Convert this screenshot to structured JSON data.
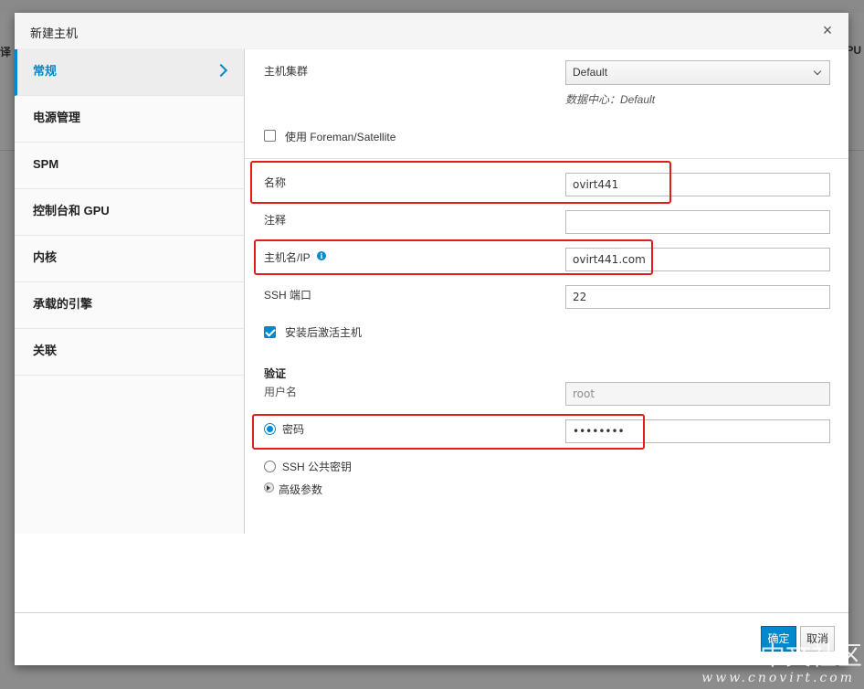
{
  "background": {
    "left_text": "译",
    "right_text": "PU"
  },
  "dialog": {
    "title": "新建主机",
    "close_label": "×"
  },
  "sidebar": {
    "items": [
      {
        "label": "常规"
      },
      {
        "label": "电源管理"
      },
      {
        "label": "SPM"
      },
      {
        "label": "控制台和 GPU"
      },
      {
        "label": "内核"
      },
      {
        "label": "承载的引擎"
      },
      {
        "label": "关联"
      }
    ]
  },
  "form": {
    "cluster": {
      "label": "主机集群",
      "value": "Default",
      "hint": "数据中心：Default"
    },
    "foreman": {
      "label": "使用 Foreman/Satellite",
      "checked": false
    },
    "name": {
      "label": "名称",
      "value": "ovirt441"
    },
    "comment": {
      "label": "注释",
      "value": ""
    },
    "hostname": {
      "label": "主机名/IP",
      "value": "ovirt441.com",
      "info_icon": "info-icon"
    },
    "ssh_port": {
      "label": "SSH 端口",
      "value": "22"
    },
    "activate": {
      "label": "安装后激活主机",
      "checked": true
    },
    "auth": {
      "title": "验证",
      "username_label": "用户名",
      "username_value": "root",
      "password_label": "密码",
      "password_value": "••••••••",
      "password_selected": true,
      "ssh_key_label": "SSH 公共密钥"
    },
    "advanced_label": "高级参数"
  },
  "footer": {
    "ok_label": "确定",
    "cancel_label": "取消"
  },
  "watermark": {
    "line1": "oVirt中文社区",
    "line2": "www.cnovirt.com"
  },
  "colors": {
    "accent": "#0088ce",
    "highlight": "#e41b1b"
  }
}
